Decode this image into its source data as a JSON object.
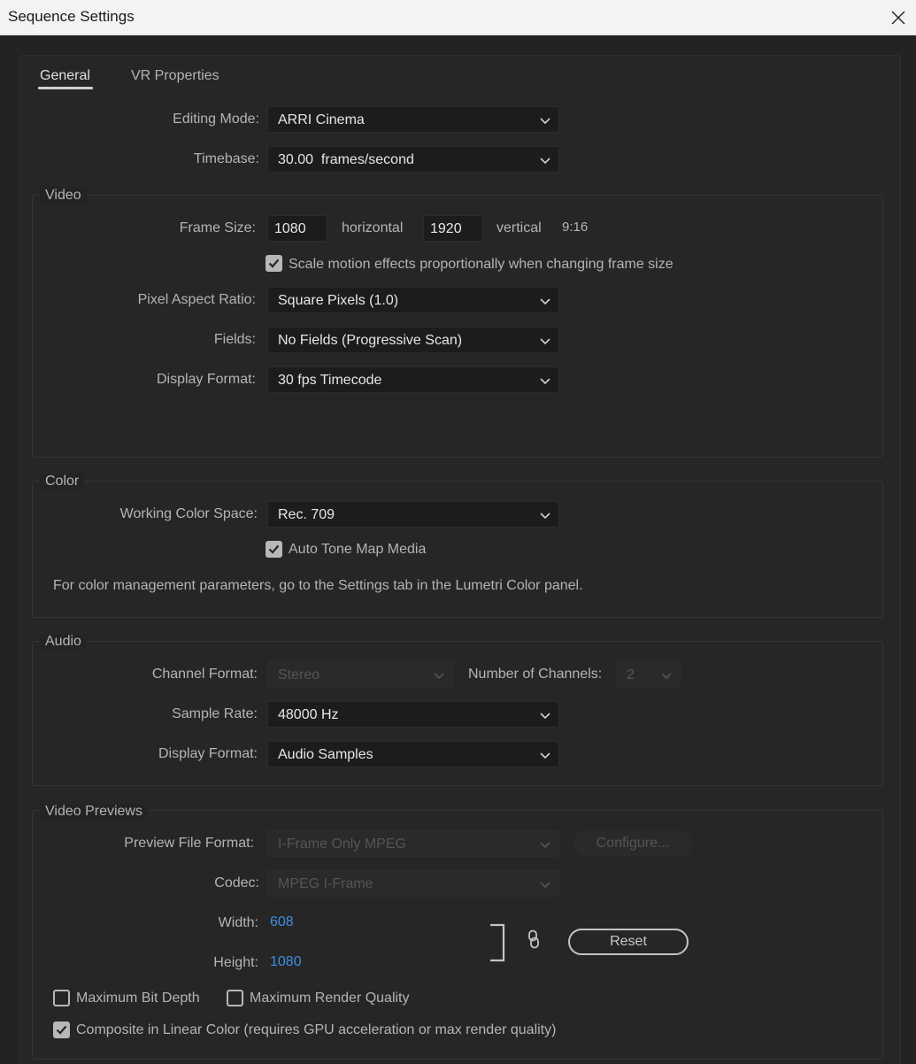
{
  "window": {
    "title": "Sequence Settings"
  },
  "tabs": [
    {
      "label": "General"
    },
    {
      "label": "VR Properties"
    }
  ],
  "editing_mode": {
    "label": "Editing Mode:",
    "value": "ARRI Cinema"
  },
  "timebase": {
    "label": "Timebase:",
    "value": "30.00  frames/second"
  },
  "video": {
    "title": "Video",
    "frame_size_label": "Frame Size:",
    "width": "1080",
    "horizontal_label": "horizontal",
    "height": "1920",
    "vertical_label": "vertical",
    "aspect": "9:16",
    "scale_motion_label": "Scale motion effects proportionally when changing frame size",
    "scale_motion_checked": true,
    "par_label": "Pixel Aspect Ratio:",
    "par_value": "Square Pixels (1.0)",
    "fields_label": "Fields:",
    "fields_value": "No Fields (Progressive Scan)",
    "display_format_label": "Display Format:",
    "display_format_value": "30 fps Timecode"
  },
  "color": {
    "title": "Color",
    "working_space_label": "Working Color Space:",
    "working_space_value": "Rec. 709",
    "auto_tone_label": "Auto Tone Map Media",
    "auto_tone_checked": true,
    "note": "For color management parameters, go to the Settings tab in the Lumetri Color panel."
  },
  "audio": {
    "title": "Audio",
    "channel_format_label": "Channel Format:",
    "channel_format_value": "Stereo",
    "num_channels_label": "Number of Channels:",
    "num_channels_value": "2",
    "sample_rate_label": "Sample Rate:",
    "sample_rate_value": "48000 Hz",
    "display_format_label": "Display Format:",
    "display_format_value": "Audio Samples"
  },
  "previews": {
    "title": "Video Previews",
    "file_format_label": "Preview File Format:",
    "file_format_value": "I-Frame Only MPEG",
    "configure_label": "Configure...",
    "codec_label": "Codec:",
    "codec_value": "MPEG I-Frame",
    "width_label": "Width:",
    "width_value": "608",
    "height_label": "Height:",
    "height_value": "1080",
    "reset_label": "Reset",
    "max_bit_depth_label": "Maximum Bit Depth",
    "max_bit_depth_checked": false,
    "max_render_quality_label": "Maximum Render Quality",
    "max_render_quality_checked": false,
    "composite_linear_label": "Composite in Linear Color (requires GPU acceleration or max render quality)",
    "composite_linear_checked": true
  },
  "icons": {
    "close": "close-icon",
    "chevron": "chevron-down-icon",
    "check": "checkmark-icon",
    "link": "link-icon"
  }
}
